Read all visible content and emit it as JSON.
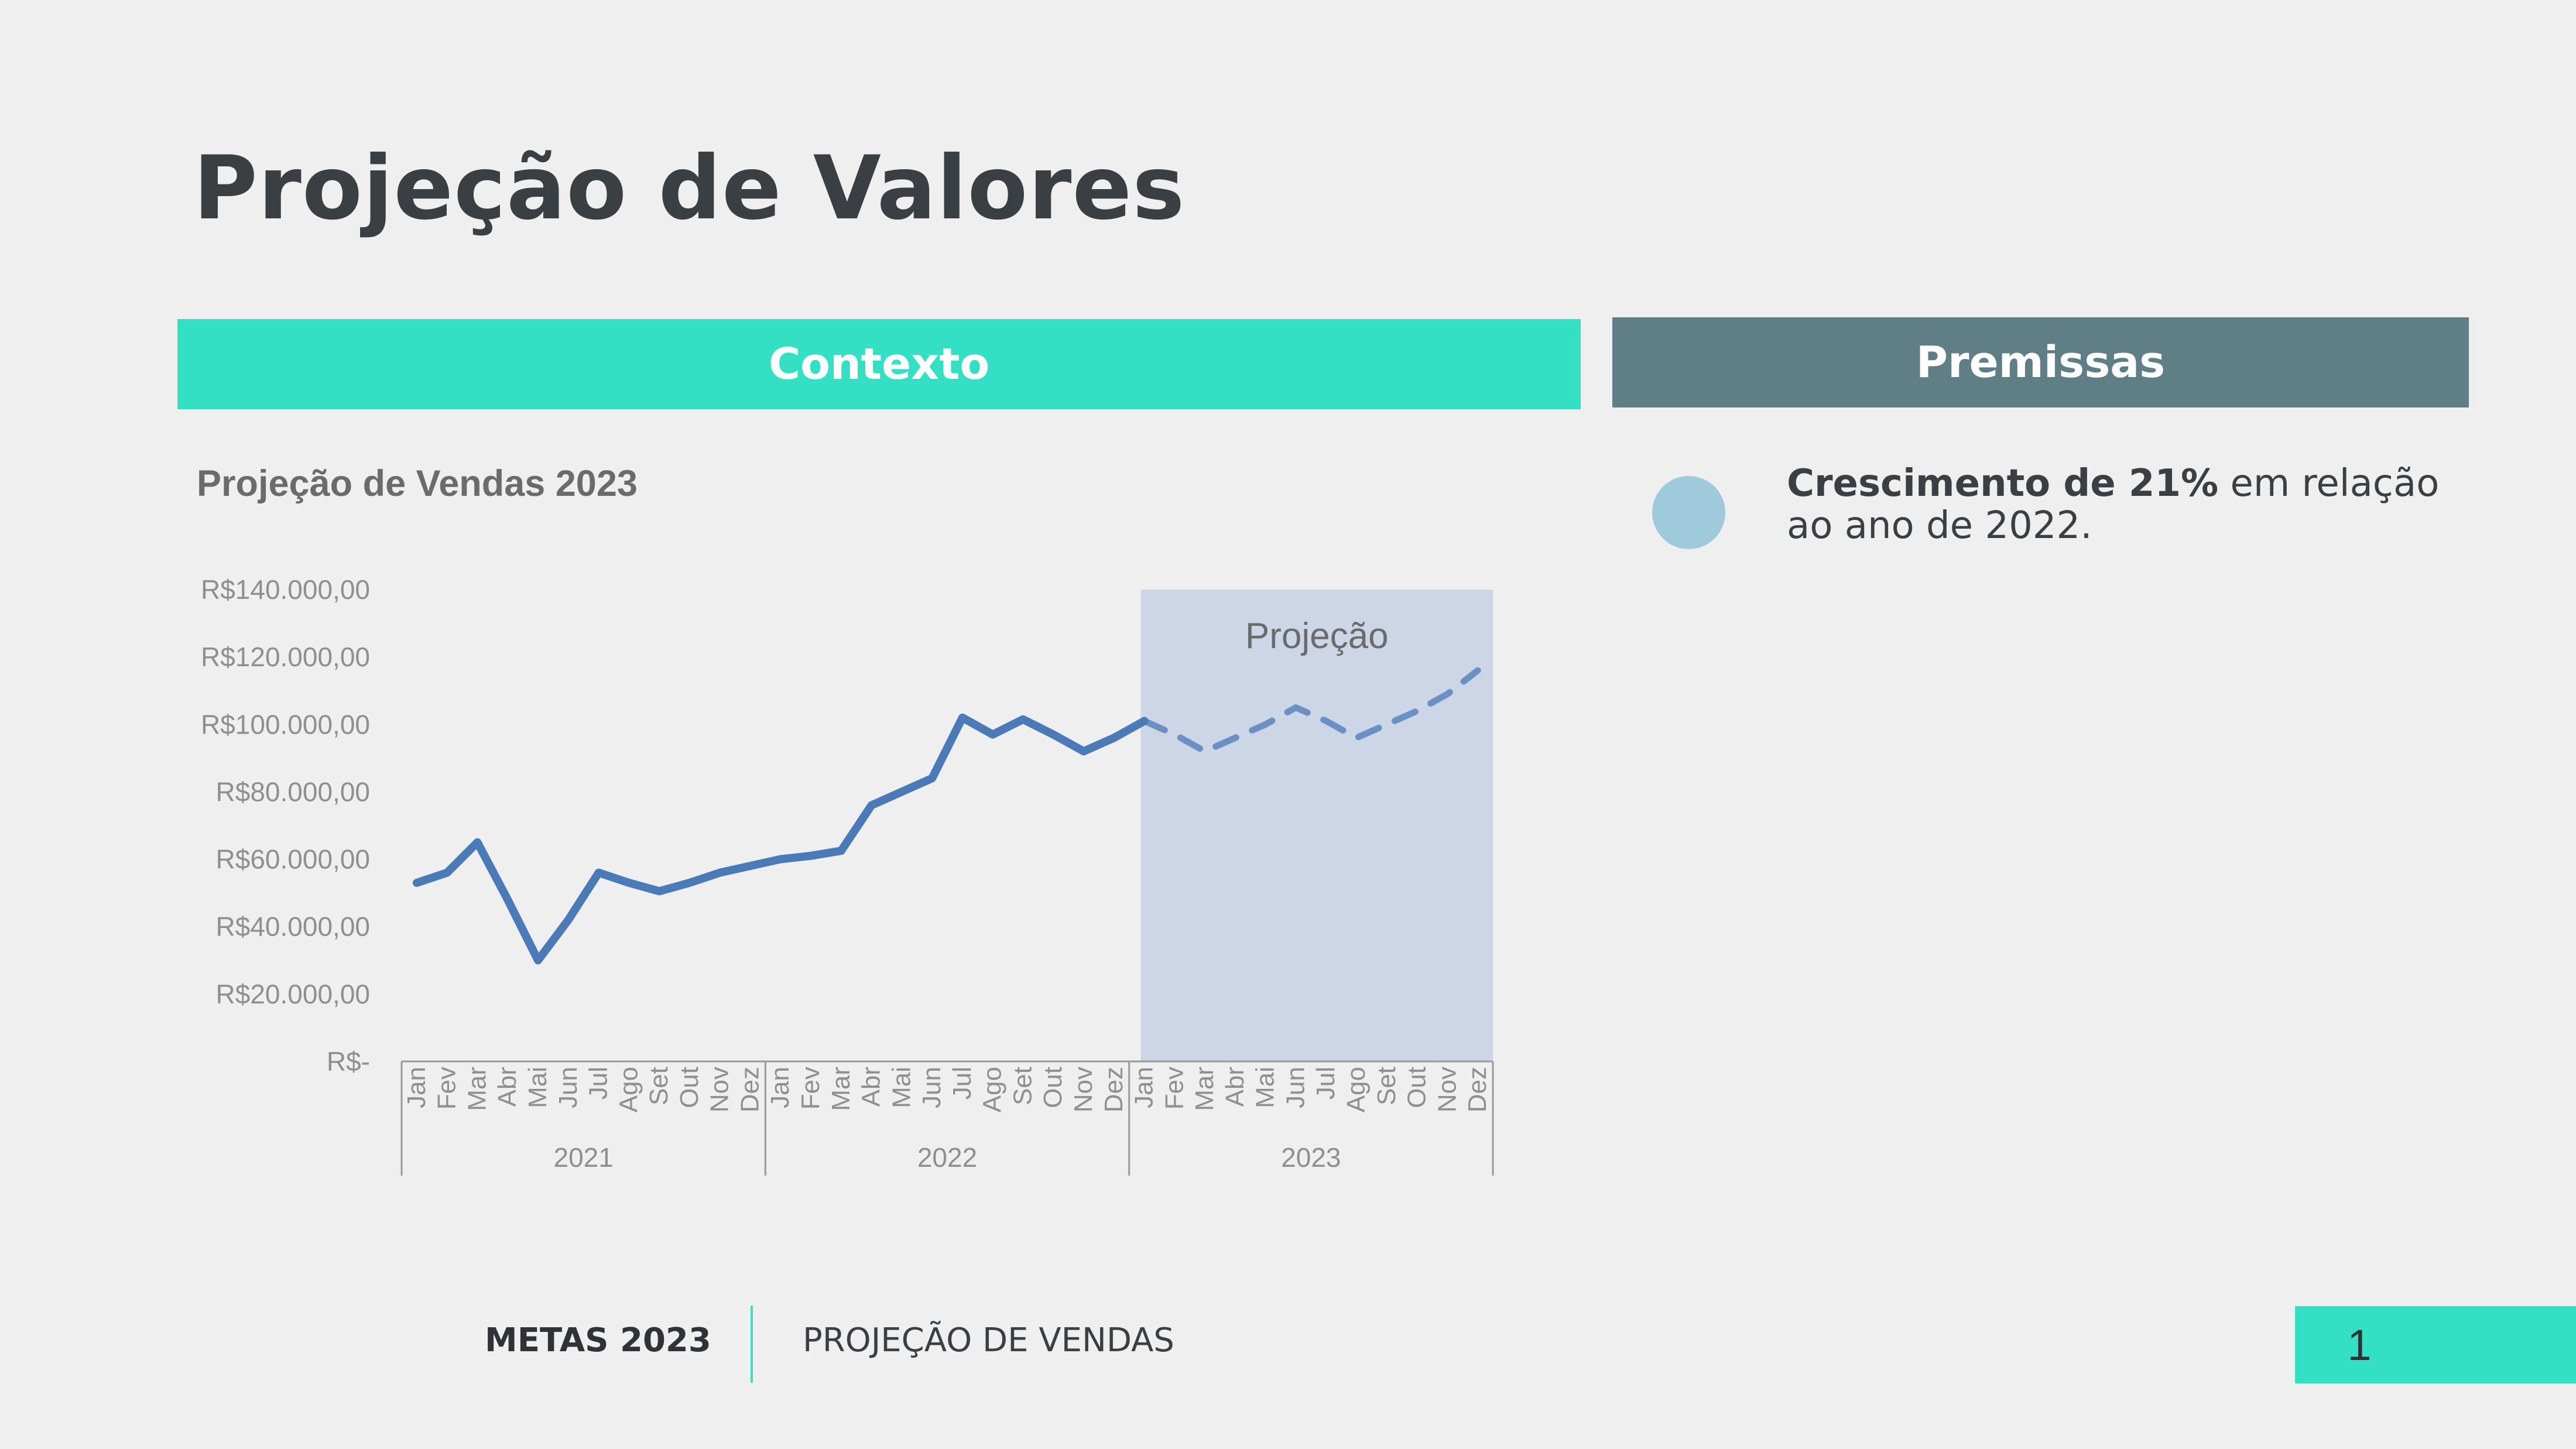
{
  "slide": {
    "title": "Projeção de Valores",
    "context_header": "Contexto",
    "premises_header": "Premissas",
    "premise_bold": "Crescimento de 21%",
    "premise_rest": " em relação ao ano de 2022.",
    "footer_left": "METAS 2023",
    "footer_right": "PROJEÇÃO DE VENDAS",
    "page_number": "1"
  },
  "colors": {
    "accent": "#33e0c4",
    "header_dark": "#5f7e86",
    "line": "#4a7ab8",
    "projection_band": "#cdd6e7",
    "bullet": "#9ecadb"
  },
  "chart_data": {
    "type": "line",
    "title": "Projeção de Vendas 2023",
    "ylim": [
      0,
      140000
    ],
    "y_ticks": [
      "R$-",
      "R$20.000,00",
      "R$40.000,00",
      "R$60.000,00",
      "R$80.000,00",
      "R$100.000,00",
      "R$120.000,00",
      "R$140.000,00"
    ],
    "months": [
      "Jan",
      "Fev",
      "Mar",
      "Abr",
      "Mai",
      "Jun",
      "Jul",
      "Ago",
      "Set",
      "Out",
      "Nov",
      "Dez"
    ],
    "years": [
      "2021",
      "2022",
      "2023"
    ],
    "projection_label": "Projeção",
    "series": [
      {
        "style": "solid",
        "values": [
          53000,
          56000,
          65000,
          48000,
          30000,
          42000,
          56000,
          53000,
          50500,
          53000,
          56000,
          58000,
          60000,
          61000,
          62500,
          76000,
          80000,
          84000,
          102000,
          97000,
          101500,
          97000,
          92000,
          96000,
          101000
        ]
      },
      {
        "style": "dashed",
        "values": [
          null,
          null,
          null,
          null,
          null,
          null,
          null,
          null,
          null,
          null,
          null,
          null,
          null,
          null,
          null,
          null,
          null,
          null,
          null,
          null,
          null,
          null,
          null,
          null,
          101000,
          97000,
          92000,
          96000,
          100000,
          105000,
          101000,
          96000,
          100000,
          104000,
          109000,
          116000
        ]
      }
    ]
  }
}
